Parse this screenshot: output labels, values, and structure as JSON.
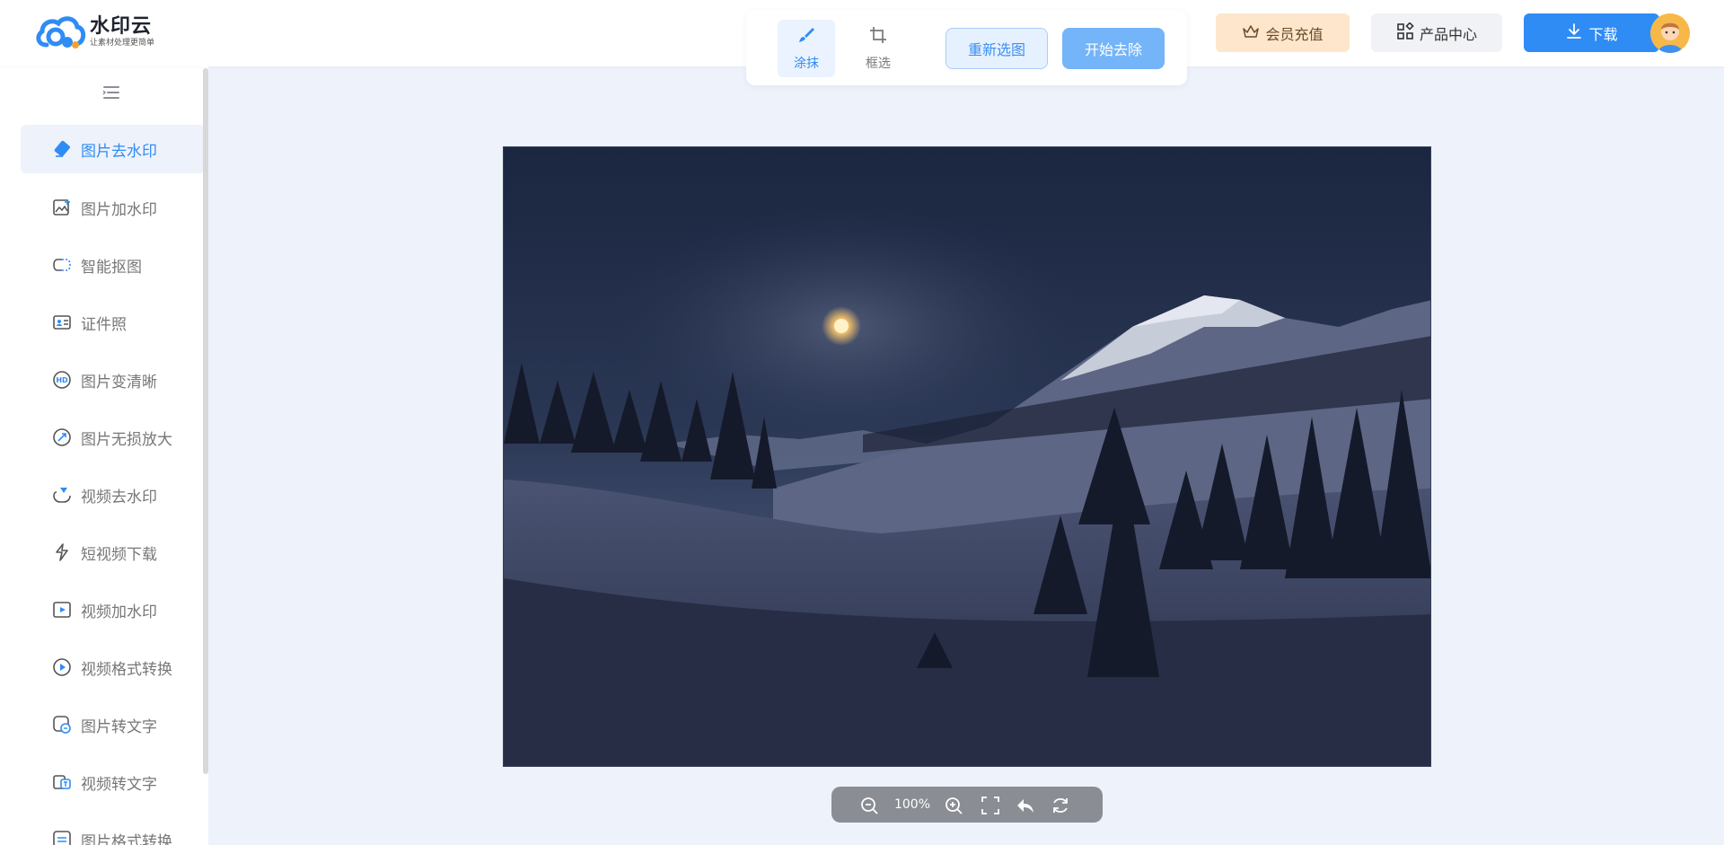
{
  "app": {
    "name": "水印云",
    "slogan": "让素材处理更简单"
  },
  "toolbar": {
    "tools": [
      {
        "label": "涂抹",
        "icon": "brush-icon",
        "active": true
      },
      {
        "label": "框选",
        "icon": "crop-icon",
        "active": false
      }
    ],
    "reselect_label": "重新选图",
    "start_label": "开始去除"
  },
  "header": {
    "vip_label": "会员充值",
    "products_label": "产品中心",
    "download_label": "下载"
  },
  "sidebar": {
    "items": [
      {
        "label": "图片去水印",
        "icon": "eraser-icon",
        "active": true
      },
      {
        "label": "图片加水印",
        "icon": "image-add-icon"
      },
      {
        "label": "智能抠图",
        "icon": "cutout-icon"
      },
      {
        "label": "证件照",
        "icon": "id-card-icon"
      },
      {
        "label": "图片变清晰",
        "icon": "hd-icon"
      },
      {
        "label": "图片无损放大",
        "icon": "enlarge-icon"
      },
      {
        "label": "视频去水印",
        "icon": "video-eraser-icon"
      },
      {
        "label": "短视频下载",
        "icon": "short-video-icon"
      },
      {
        "label": "视频加水印",
        "icon": "video-add-icon"
      },
      {
        "label": "视频格式转换",
        "icon": "video-convert-icon"
      },
      {
        "label": "图片转文字",
        "icon": "image-text-icon"
      },
      {
        "label": "视频转文字",
        "icon": "video-text-icon"
      },
      {
        "label": "图片格式转换",
        "icon": "image-convert-icon"
      }
    ]
  },
  "zoom": {
    "value": "100%"
  },
  "colors": {
    "accent": "#2f8cf5",
    "canvas_bg": "#eef2fa",
    "vip_bg": "#fde6cb"
  }
}
